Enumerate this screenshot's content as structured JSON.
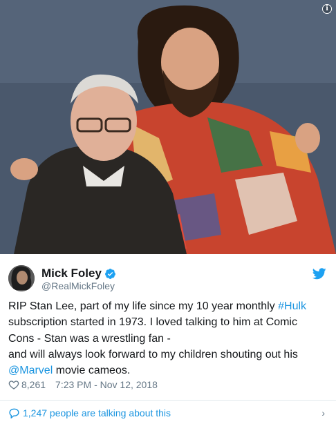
{
  "tweet": {
    "author_name": "Mick Foley",
    "handle": "@RealMickFoley",
    "text_lines": [
      [
        "RIP Stan Lee, part of my life since my 10 year monthly ",
        "#Hulk",
        ""
      ],
      [
        "subscription started in 1973. I loved talking to him at Comic",
        "",
        ""
      ],
      [
        "Cons - Stan was a wrestling fan -",
        "",
        ""
      ],
      [
        "and will always look forward to my children shouting out his",
        "",
        ""
      ],
      [
        "",
        "@Marvel",
        " movie cameos."
      ]
    ],
    "likes": "8,261",
    "timestamp": "7:23 PM - Nov 12, 2018",
    "talking": "1,247 people are talking about this"
  },
  "icons": {
    "info": "i",
    "verified": "verified-badge-icon",
    "bird": "twitter-bird-icon",
    "heart": "heart-icon",
    "comment": "comment-bubble-icon",
    "chevron": "›"
  },
  "colors": {
    "link": "#1b95e0",
    "secondary_text": "#657786",
    "divider": "#e1e8ed"
  }
}
